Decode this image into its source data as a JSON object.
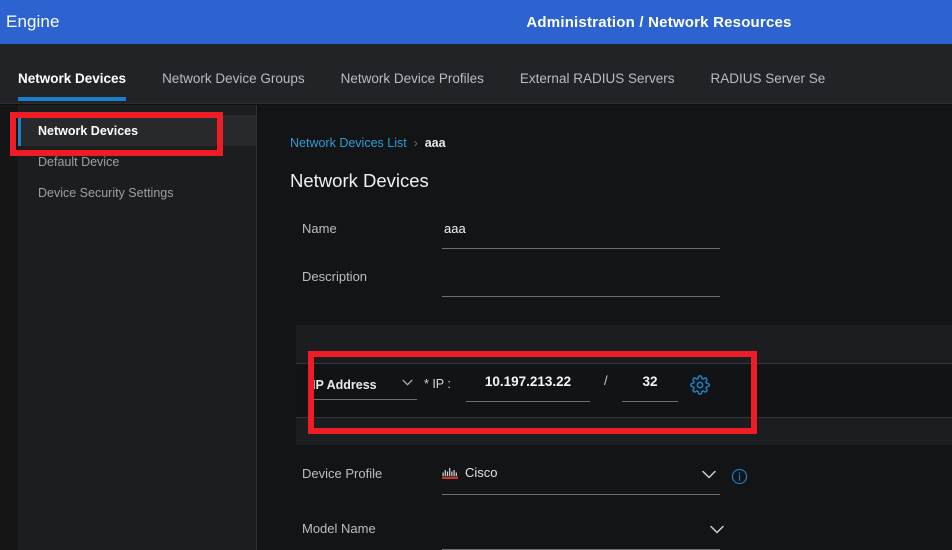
{
  "header": {
    "brand": "Engine",
    "title": "Administration / Network Resources",
    "brand_bg": "#2c63d0"
  },
  "tabs": [
    {
      "label": "Network Devices",
      "active": true
    },
    {
      "label": "Network Device Groups",
      "active": false
    },
    {
      "label": "Network Device Profiles",
      "active": false
    },
    {
      "label": "External RADIUS Servers",
      "active": false
    },
    {
      "label": "RADIUS Server Se",
      "active": false
    }
  ],
  "sidebar": {
    "items": [
      {
        "label": "Network Devices",
        "selected": true
      },
      {
        "label": "Default Device",
        "selected": false
      },
      {
        "label": "Device Security Settings",
        "selected": false
      }
    ]
  },
  "breadcrumb": {
    "link": "Network Devices List",
    "separator": "›",
    "current": "aaa"
  },
  "page": {
    "title": "Network Devices"
  },
  "form": {
    "name": {
      "label": "Name",
      "value": "aaa"
    },
    "description": {
      "label": "Description",
      "value": ""
    },
    "ip": {
      "type_label": "IP Address",
      "required_label": "* IP :",
      "address": "10.197.213.22",
      "separator": "/",
      "mask": "32",
      "gear_icon": "gear-icon"
    },
    "device_profile": {
      "label": "Device Profile",
      "value": "Cisco",
      "logo": "cisco-logo",
      "info_icon": "info-icon"
    },
    "model_name": {
      "label": "Model Name",
      "value": ""
    }
  },
  "annotations": {
    "color": "#ee1c24",
    "boxes": [
      "sidebar-network-devices",
      "ip-address-row"
    ]
  },
  "colors": {
    "accent_blue": "#1a7fc4",
    "link_blue": "#2f9bd8",
    "header_blue": "#2c63d0",
    "annotation_red": "#ee1c24"
  }
}
